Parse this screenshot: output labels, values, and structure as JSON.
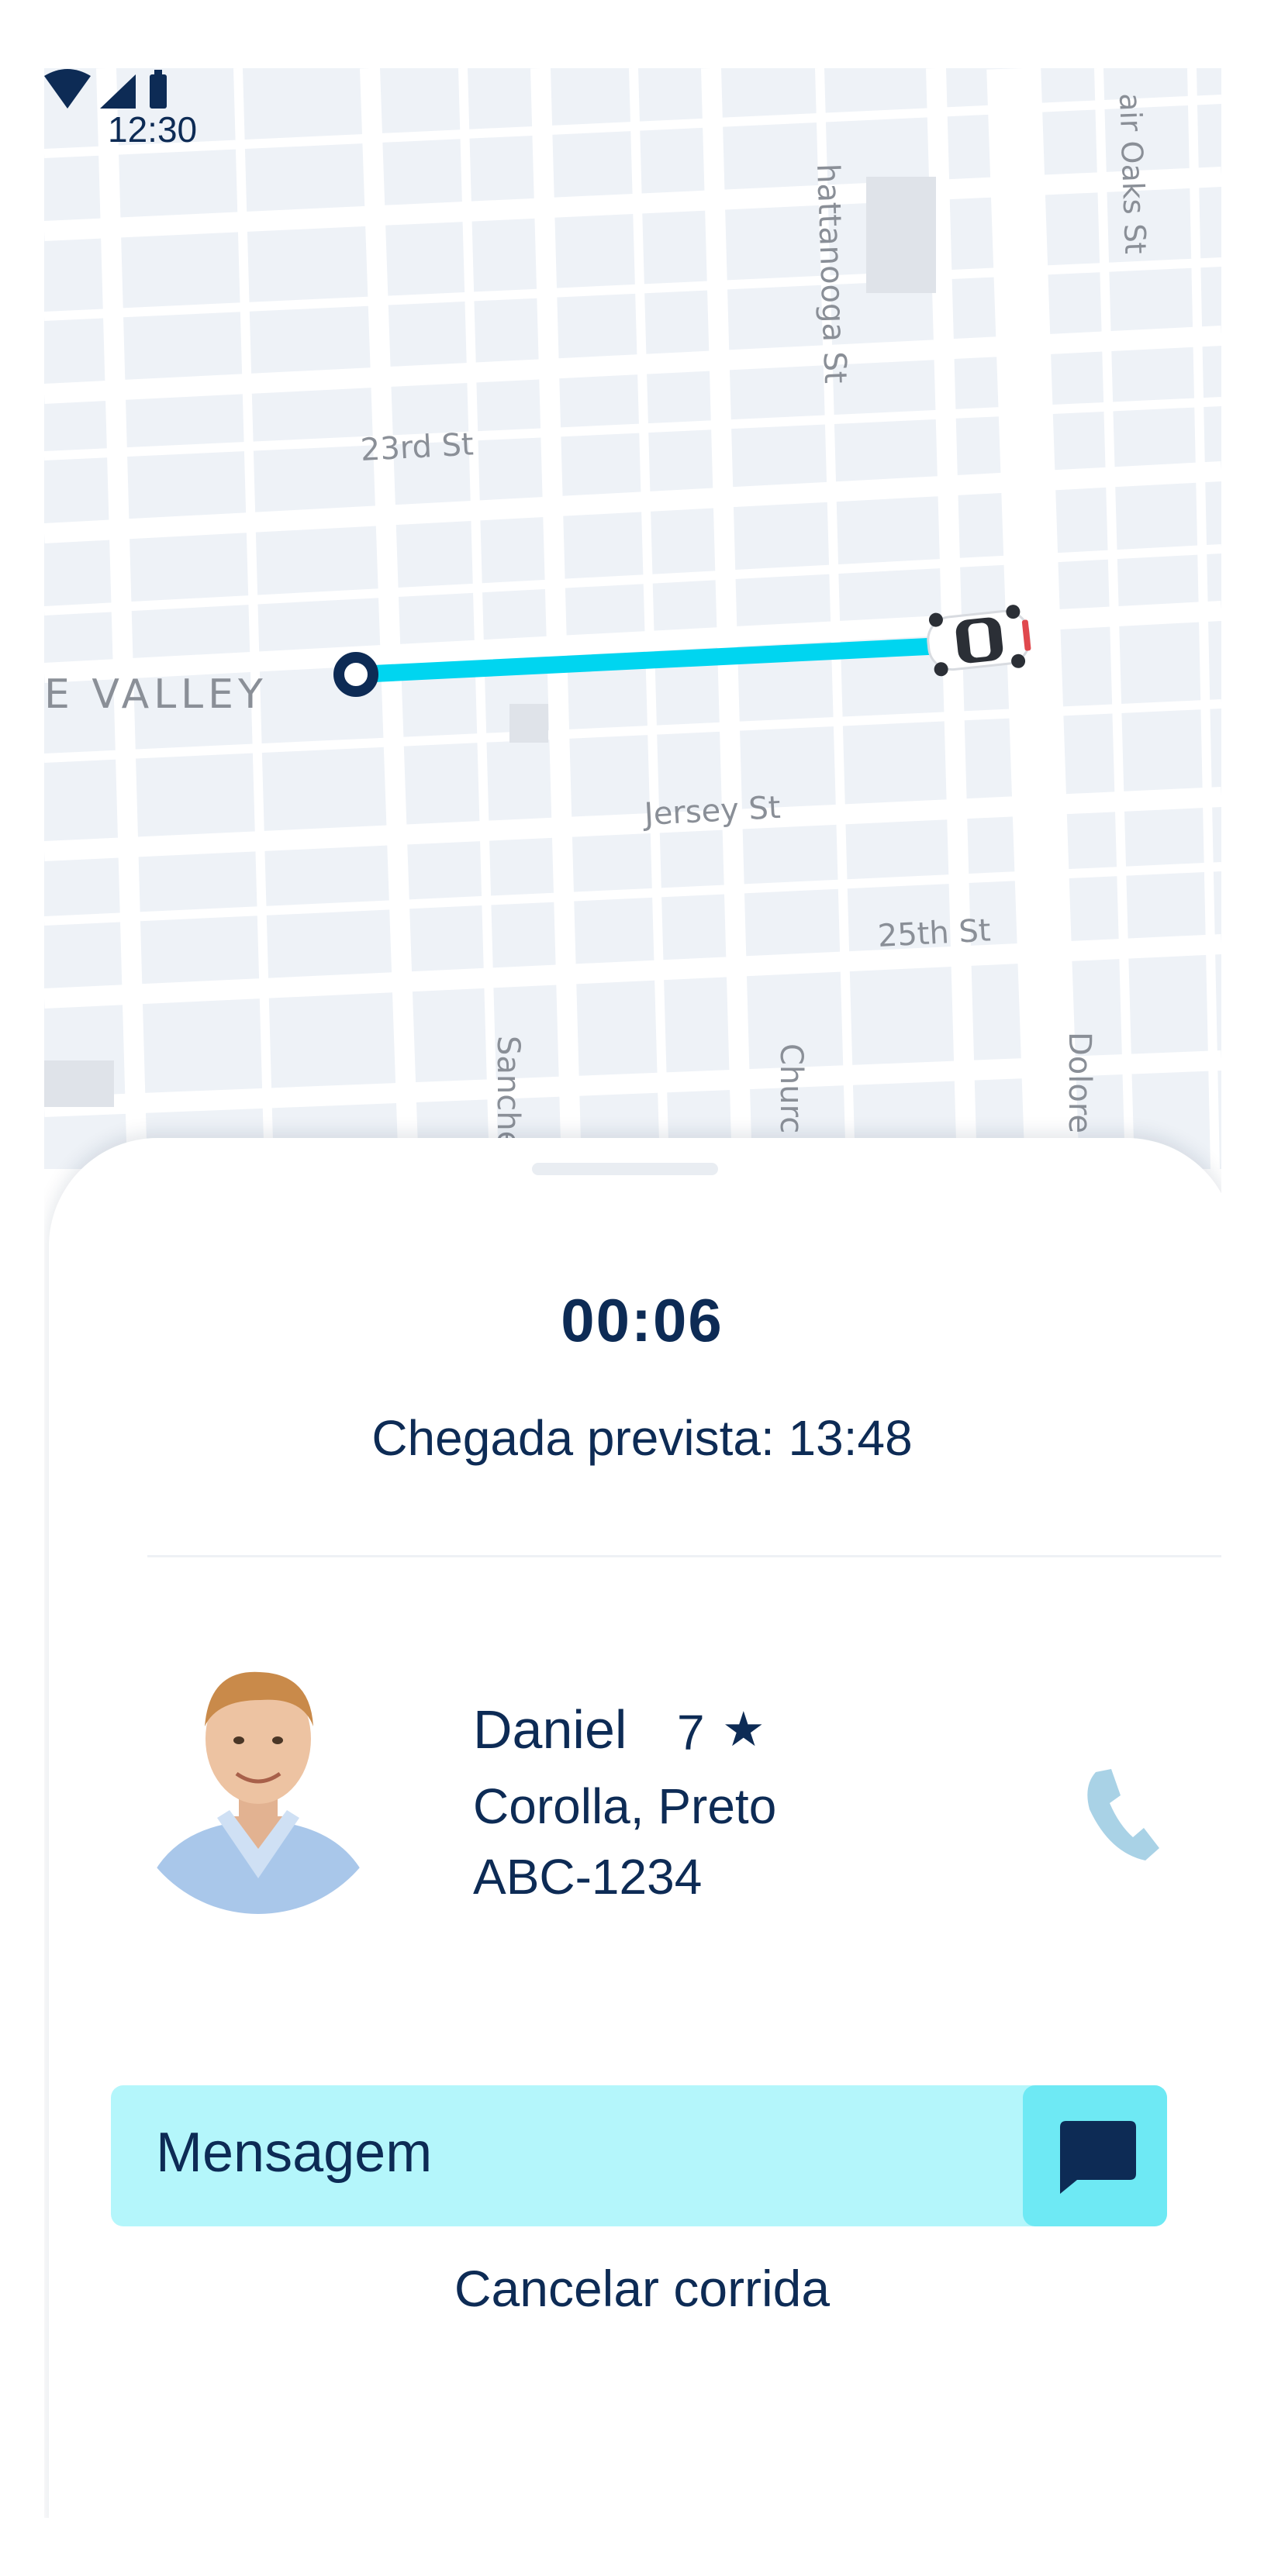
{
  "status_bar": {
    "time": "12:30"
  },
  "map": {
    "street_labels": {
      "chattanooga": "hattanooga St",
      "fair_oaks": "air Oaks St",
      "st23": "23rd St",
      "valley": "E VALLEY",
      "jersey": "Jersey St",
      "st25": "25th St",
      "sanchez": "Sanche",
      "church": "Churc",
      "dolores": "Dolore"
    },
    "colors": {
      "route": "#00d5f0",
      "pin": "#0d2b55"
    }
  },
  "trip": {
    "timer": "00:06",
    "eta": "Chegada prevista: 13:48"
  },
  "driver": {
    "name": "Daniel",
    "rating": "7",
    "rating_icon": "star-icon",
    "car": "Corolla, Preto",
    "plate": "ABC-1234"
  },
  "message": {
    "placeholder": "Mensagem",
    "icon": "chat-icon"
  },
  "actions": {
    "cancel": "Cancelar corrida"
  },
  "colors": {
    "primary_text": "#0d2b55",
    "message_bg": "#b4f6fb",
    "message_button_bg": "#6ee9f4"
  }
}
